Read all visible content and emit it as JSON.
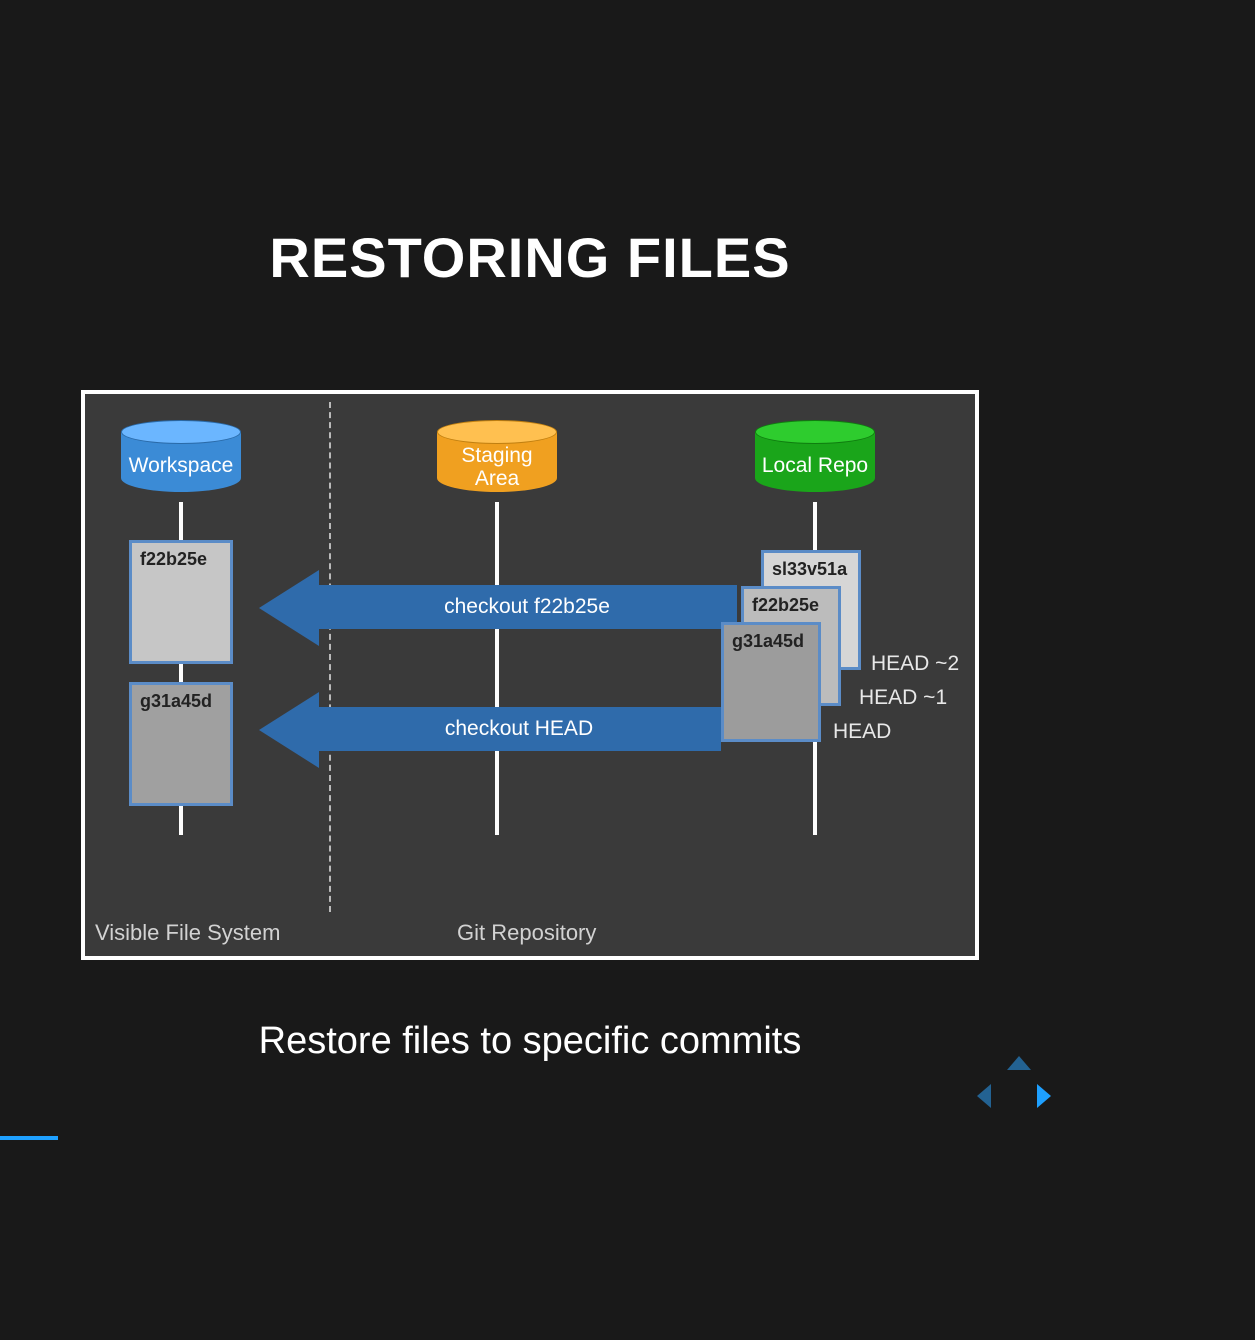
{
  "title": "RESTORING FILES",
  "caption": "Restore files to specific commits",
  "cylinders": {
    "workspace": "Workspace",
    "staging": "Staging\nArea",
    "localrepo": "Local Repo"
  },
  "workspace_files": {
    "file1": "f22b25e",
    "file2": "g31a45d"
  },
  "commits": {
    "c3": "sl33v51a",
    "c2": "f22b25e",
    "c1": "g31a45d"
  },
  "head_labels": {
    "h2": "HEAD ~2",
    "h1": "HEAD ~1",
    "h0": "HEAD"
  },
  "arrows": {
    "a1": "checkout f22b25e",
    "a2": "checkout HEAD"
  },
  "regions": {
    "visible_fs": "Visible File System",
    "git_repo": "Git Repository"
  },
  "colors": {
    "workspace": "#3b8bd6",
    "staging": "#f0a020",
    "localrepo": "#1aa51a",
    "arrow": "#2f6bab",
    "accent": "#1ea0ff"
  }
}
